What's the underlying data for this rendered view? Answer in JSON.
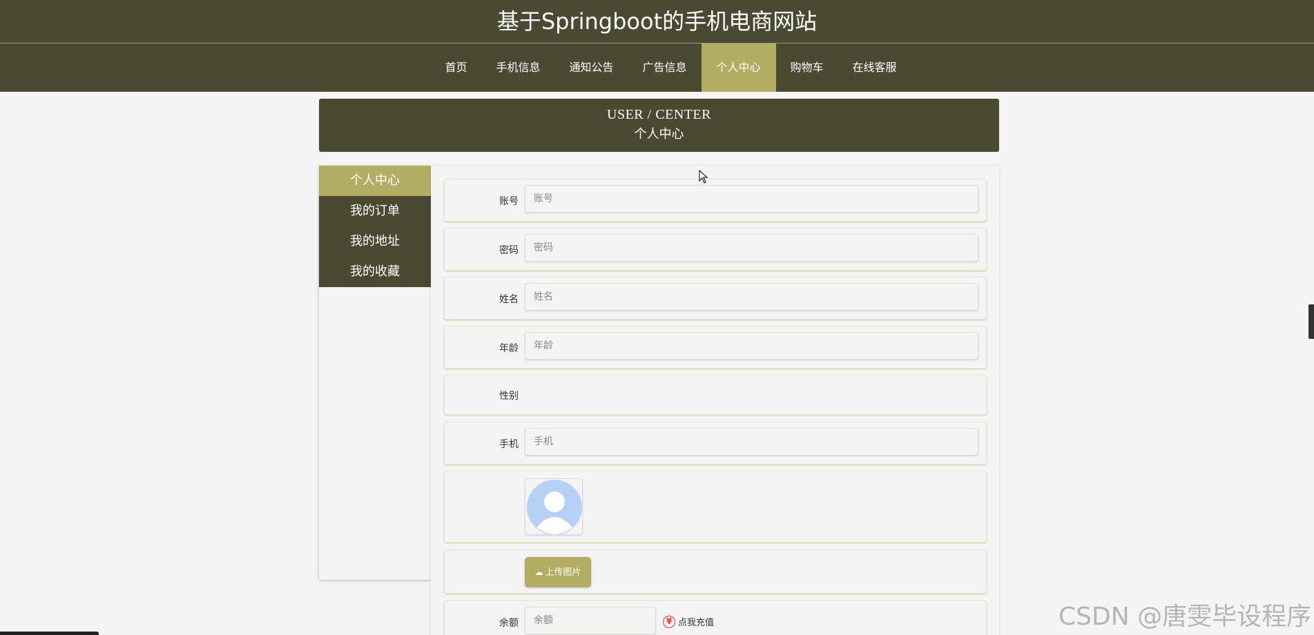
{
  "site_title": "基于Springboot的手机电商网站",
  "nav": {
    "items": [
      {
        "label": "首页",
        "active": false
      },
      {
        "label": "手机信息",
        "active": false
      },
      {
        "label": "通知公告",
        "active": false
      },
      {
        "label": "广告信息",
        "active": false
      },
      {
        "label": "个人中心",
        "active": true
      },
      {
        "label": "购物车",
        "active": false
      },
      {
        "label": "在线客服",
        "active": false
      }
    ]
  },
  "banner": {
    "en": "USER / CENTER",
    "cn": "个人中心"
  },
  "sidebar": {
    "items": [
      {
        "label": "个人中心",
        "active": true
      },
      {
        "label": "我的订单",
        "active": false
      },
      {
        "label": "我的地址",
        "active": false
      },
      {
        "label": "我的收藏",
        "active": false
      }
    ]
  },
  "form": {
    "account": {
      "label": "账号",
      "placeholder": "账号",
      "value": ""
    },
    "password": {
      "label": "密码",
      "placeholder": "密码",
      "value": ""
    },
    "name": {
      "label": "姓名",
      "placeholder": "姓名",
      "value": ""
    },
    "age": {
      "label": "年龄",
      "placeholder": "年龄",
      "value": ""
    },
    "gender": {
      "label": "性别"
    },
    "phone": {
      "label": "手机",
      "placeholder": "手机",
      "value": ""
    },
    "avatar": {
      "icon": "default-avatar-icon"
    },
    "upload_button": {
      "label": "上传图片",
      "icon": "cloud-upload-icon"
    },
    "balance": {
      "label": "余额",
      "placeholder": "余额",
      "value": ""
    },
    "recharge": {
      "label": "点我充值",
      "icon": "yen-icon",
      "icon_symbol": "¥"
    }
  },
  "watermark": "CSDN @唐雯毕设程序",
  "colors": {
    "header_bg": "#4a4a33",
    "accent": "#b3ad63",
    "page_bg": "#f4f4f4",
    "recharge_icon": "#ee3333"
  }
}
